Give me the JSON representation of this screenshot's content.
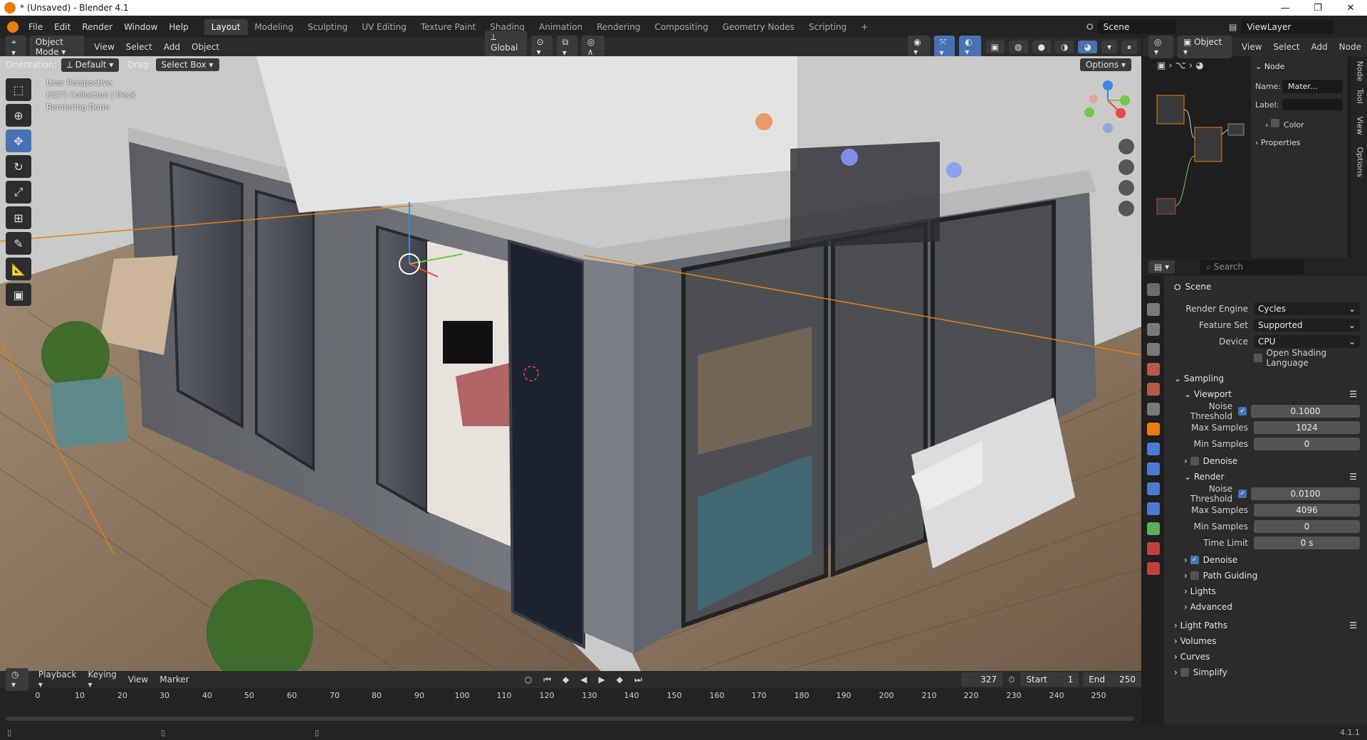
{
  "window": {
    "title": "* (Unsaved) - Blender 4.1",
    "minimize": "—",
    "maximize": "❐",
    "close": "✕"
  },
  "menu": [
    "File",
    "Edit",
    "Render",
    "Window",
    "Help"
  ],
  "workspaces": [
    "Layout",
    "Modeling",
    "Sculpting",
    "UV Editing",
    "Texture Paint",
    "Shading",
    "Animation",
    "Rendering",
    "Compositing",
    "Geometry Nodes",
    "Scripting",
    "+"
  ],
  "active_workspace": "Layout",
  "scene_field": "Scene",
  "viewlayer_field": "ViewLayer",
  "viewport_header": {
    "mode": "Object Mode",
    "menus": [
      "View",
      "Select",
      "Add",
      "Object"
    ],
    "transform_orientation": "Global",
    "options": "Options"
  },
  "tool_header": {
    "orientation_label": "Orientation:",
    "orientation_value": "Default",
    "drag_label": "Drag:",
    "drag_value": "Select Box"
  },
  "viewport_overlay": {
    "line1": "User Perspective",
    "line2": "(327) Collection | Deck",
    "line3": "Rendering Done"
  },
  "node_editor": {
    "mode": "Object",
    "menus": [
      "View",
      "Select",
      "Add",
      "Node"
    ],
    "sidebar": {
      "section": "Node",
      "name_label": "Name:",
      "name_value": "Mater...",
      "label_label": "Label:",
      "color": "Color",
      "properties": "Properties"
    },
    "tabs": [
      "Node",
      "Tool",
      "View",
      "Options"
    ]
  },
  "properties": {
    "search_placeholder": "Search",
    "context": "Scene",
    "render_engine_label": "Render Engine",
    "render_engine_value": "Cycles",
    "feature_set_label": "Feature Set",
    "feature_set_value": "Supported",
    "device_label": "Device",
    "device_value": "CPU",
    "osl": "Open Shading Language",
    "sampling": "Sampling",
    "viewport": "Viewport",
    "vp_noise_label": "Noise Threshold",
    "vp_noise_value": "0.1000",
    "vp_max_label": "Max Samples",
    "vp_max_value": "1024",
    "vp_min_label": "Min Samples",
    "vp_min_value": "0",
    "vp_denoise": "Denoise",
    "render": "Render",
    "r_noise_label": "Noise Threshold",
    "r_noise_value": "0.0100",
    "r_max_label": "Max Samples",
    "r_max_value": "4096",
    "r_min_label": "Min Samples",
    "r_min_value": "0",
    "r_time_label": "Time Limit",
    "r_time_value": "0 s",
    "r_denoise": "Denoise",
    "path_guiding": "Path Guiding",
    "lights": "Lights",
    "advanced": "Advanced",
    "light_paths": "Light Paths",
    "volumes": "Volumes",
    "curves": "Curves",
    "simplify": "Simplify"
  },
  "timeline": {
    "menus": [
      "Playback",
      "Keying",
      "View",
      "Marker"
    ],
    "current_frame": "327",
    "start_label": "Start",
    "start_value": "1",
    "end_label": "End",
    "end_value": "250",
    "ruler": [
      "0",
      "10",
      "20",
      "30",
      "40",
      "50",
      "60",
      "70",
      "80",
      "90",
      "100",
      "110",
      "120",
      "130",
      "140",
      "150",
      "160",
      "170",
      "180",
      "190",
      "200",
      "210",
      "220",
      "230",
      "240",
      "250"
    ]
  },
  "status": {
    "version": "4.1.1"
  },
  "colors": {
    "accent": "#4772b3",
    "selection_orange": "#e87d0d"
  }
}
